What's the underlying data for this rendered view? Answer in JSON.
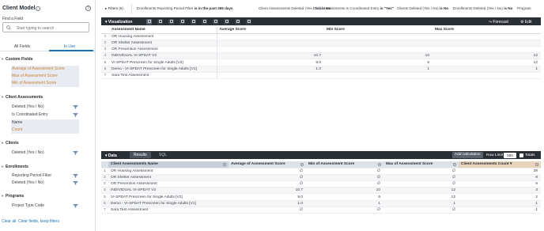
{
  "left_panel": {
    "title": "Client Model",
    "find_label": "Find a Field",
    "search_placeholder": "Start typing to search",
    "tabs": [
      "All Fields",
      "In Use"
    ],
    "sections": [
      {
        "label": "Custom Fields",
        "items": [
          {
            "label": "Average of Assessment Score"
          },
          {
            "label": "Max of Assessment Score"
          },
          {
            "label": "Min of Assessment Score"
          }
        ]
      },
      {
        "label": "Client Assessments",
        "items": [
          {
            "label": "Deleted (Yes / No)"
          },
          {
            "label": "Is Coordinated Entry"
          },
          {
            "label": "Name"
          },
          {
            "label": "Count"
          }
        ]
      },
      {
        "label": "Clients",
        "items": [
          {
            "label": "Deleted (Yes / No)"
          }
        ]
      },
      {
        "label": "Enrollments",
        "items": [
          {
            "label": "Reporting Period Filter"
          },
          {
            "label": "Deleted (Yes / No)"
          }
        ]
      },
      {
        "label": "Programs",
        "items": [
          {
            "label": "Project Type Code"
          }
        ]
      }
    ],
    "footer": {
      "clear_all": "Clear all",
      "clear_keep": "Clear fields, keep filters"
    }
  },
  "filters": {
    "header": "Filters (6)",
    "items": [
      {
        "label": "Enrollments Reporting Period Filter",
        "value": "is in the past 365 days"
      },
      {
        "label": "Client Assessments Deleted (Yes / No)",
        "value": "is No"
      },
      {
        "label": "Client Assessments Is Coordinated Entry",
        "value": "is \"Yes\""
      },
      {
        "label": "Clients Deleted (Yes / No)",
        "value": "is No"
      },
      {
        "label": "Enrollments Deleted (Yes / No)",
        "value": "is No"
      },
      {
        "label": "Program",
        "value": ""
      }
    ]
  },
  "visualization": {
    "title": "Visualization",
    "forecast": "Forecast",
    "edit": "Edit",
    "headers": [
      "Assessment Name",
      "Average Score",
      "Min Score",
      "Max Score"
    ],
    "rows": [
      {
        "num": "1",
        "name": "OR Housing Assessment",
        "avg": "",
        "min": "",
        "max": ""
      },
      {
        "num": "2",
        "name": "OR Shelter Assessment",
        "avg": "",
        "min": "",
        "max": ""
      },
      {
        "num": "3",
        "name": "OR Prevention Assessment",
        "avg": "",
        "min": "",
        "max": ""
      },
      {
        "num": "4",
        "name": "INDIVIDUAL VI-SPDAT V3",
        "avg": "10.7",
        "min": "10",
        "max": "12"
      },
      {
        "num": "5",
        "name": "VI-SPDAT Prescreen for Single Adults [V2]",
        "avg": "9.0",
        "min": "6",
        "max": "12"
      },
      {
        "num": "6",
        "name": "Demo - VI-SPDAT Prescreen for Single Adults [V1]",
        "avg": "1.0",
        "min": "1",
        "max": "1"
      },
      {
        "num": "7",
        "name": "Sara Test Assessment",
        "avg": "",
        "min": "",
        "max": ""
      }
    ]
  },
  "data": {
    "title": "Data",
    "tabs": [
      "Results",
      "SQL"
    ],
    "add_calculation": "Add calculation",
    "row_limit_label": "Row Limit",
    "row_limit_value": "500",
    "totals_label": "Totals",
    "headers": [
      "Client Assessments Name",
      "Average of Assessment Score",
      "Min of Assessment Score",
      "Max of Assessment Score",
      "Client Assessments Count"
    ],
    "rows": [
      {
        "num": "1",
        "name": "OR Housing Assessment",
        "avg": "∅",
        "min": "∅",
        "max": "∅",
        "count": "39"
      },
      {
        "num": "2",
        "name": "OR Shelter Assessment",
        "avg": "∅",
        "min": "∅",
        "max": "∅",
        "count": "8"
      },
      {
        "num": "3",
        "name": "OR Prevention Assessment",
        "avg": "∅",
        "min": "∅",
        "max": "∅",
        "count": "6"
      },
      {
        "num": "4",
        "name": "INDIVIDUAL VI-SPDAT V3",
        "avg": "10.7",
        "min": "10",
        "max": "12",
        "count": "3"
      },
      {
        "num": "5",
        "name": "VI-SPDAT Prescreen for Single Adults [V2]",
        "avg": "9.0",
        "min": "6",
        "max": "12",
        "count": "2"
      },
      {
        "num": "6",
        "name": "Demo - VI-SPDAT Prescreen for Single Adults [V1]",
        "avg": "1.0",
        "min": "1",
        "max": "1",
        "count": "1"
      },
      {
        "num": "7",
        "name": "Sara Test Assessment",
        "avg": "∅",
        "min": "∅",
        "max": "∅",
        "count": "1"
      }
    ]
  },
  "colors": {
    "accent": "#1a73b8",
    "measure": "#c98234",
    "toolbar": "#2a2f36"
  }
}
